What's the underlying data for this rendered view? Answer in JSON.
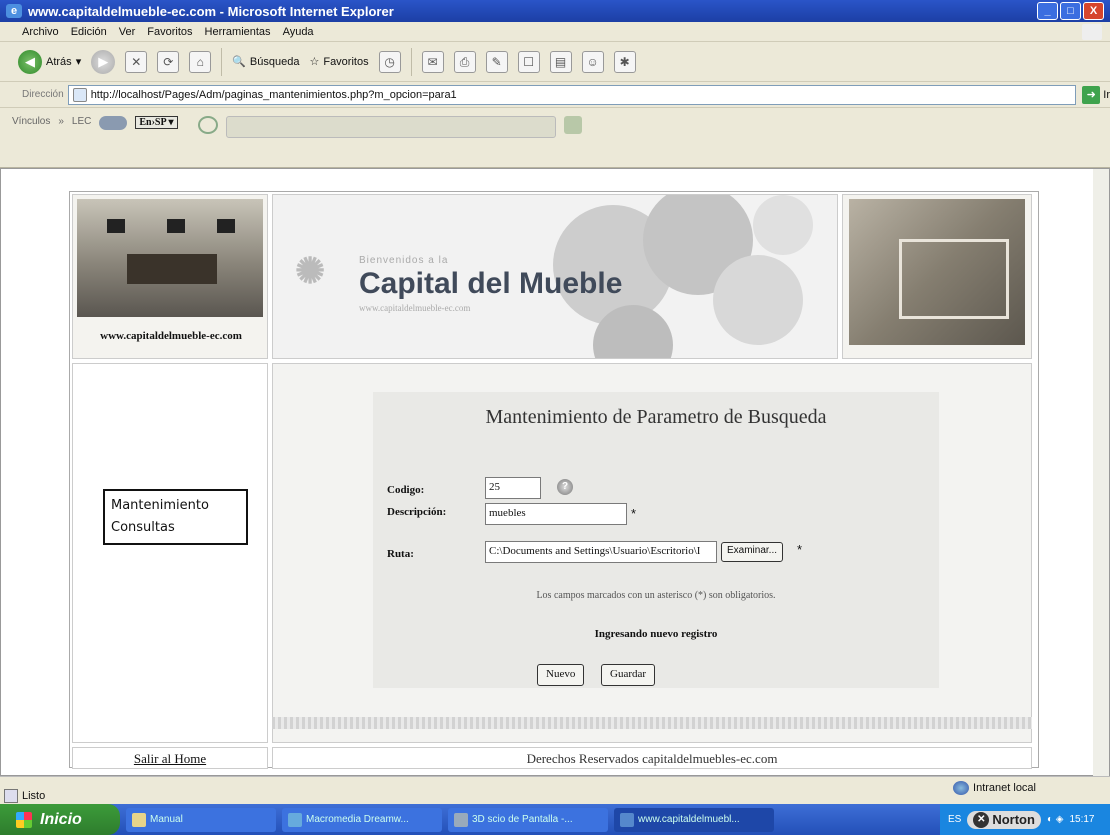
{
  "window": {
    "title": "www.capitaldelmueble-ec.com - Microsoft Internet Explorer",
    "minimize": "_",
    "maximize": "□",
    "close": "X"
  },
  "menu": [
    "Archivo",
    "Edición",
    "Ver",
    "Favoritos",
    "Herramientas",
    "Ayuda"
  ],
  "toolbar": {
    "back_label": "Atrás",
    "search_label": "Búsqueda",
    "favorites_label": "Favoritos"
  },
  "address": {
    "label": "Dirección",
    "url": "http://localhost/Pages/Adm/paginas_mantenimientos.php?m_opcion=para1",
    "go_label": "Ir"
  },
  "links": {
    "label": "Vínculos",
    "lec": "LEC",
    "translate": "En›SP ▾"
  },
  "header": {
    "site_url": "www.capitaldelmueble-ec.com",
    "brand_small": "Bienvenidos a la",
    "brand_title": "Capital del Mueble",
    "brand_sub": "www.capitaldelmueble-ec.com"
  },
  "sidebar": {
    "items": [
      {
        "label": "Mantenimiento"
      },
      {
        "label": "Consultas"
      }
    ]
  },
  "form": {
    "title": "Mantenimiento de Parametro de Busqueda",
    "codigo_label": "Codigo:",
    "codigo_value": "25",
    "descripcion_label": "Descripción:",
    "descripcion_value": "muebles",
    "ruta_label": "Ruta:",
    "ruta_value": "C:\\Documents and Settings\\Usuario\\Escritorio\\I",
    "browse_label": "Examinar...",
    "required_mark": "*",
    "note": "Los campos marcados con un asterisco (*) son obligatorios.",
    "status": "Ingresando nuevo registro",
    "new_label": "Nuevo",
    "save_label": "Guardar"
  },
  "footer": {
    "home_link": "Salir al Home",
    "rights": "Derechos Reservados capitaldelmuebles-ec.com"
  },
  "statusbar": {
    "status": "Listo",
    "zone": "Intranet local"
  },
  "taskbar": {
    "start": "Inicio",
    "tasks": [
      {
        "label": "Manual"
      },
      {
        "label": "Macromedia Dreamw..."
      },
      {
        "label": "3D scio de Pantalla -..."
      },
      {
        "label": "www.capitaldelmuebl..."
      }
    ],
    "lang": "ES",
    "norton": "Norton",
    "clock": "15:17"
  }
}
